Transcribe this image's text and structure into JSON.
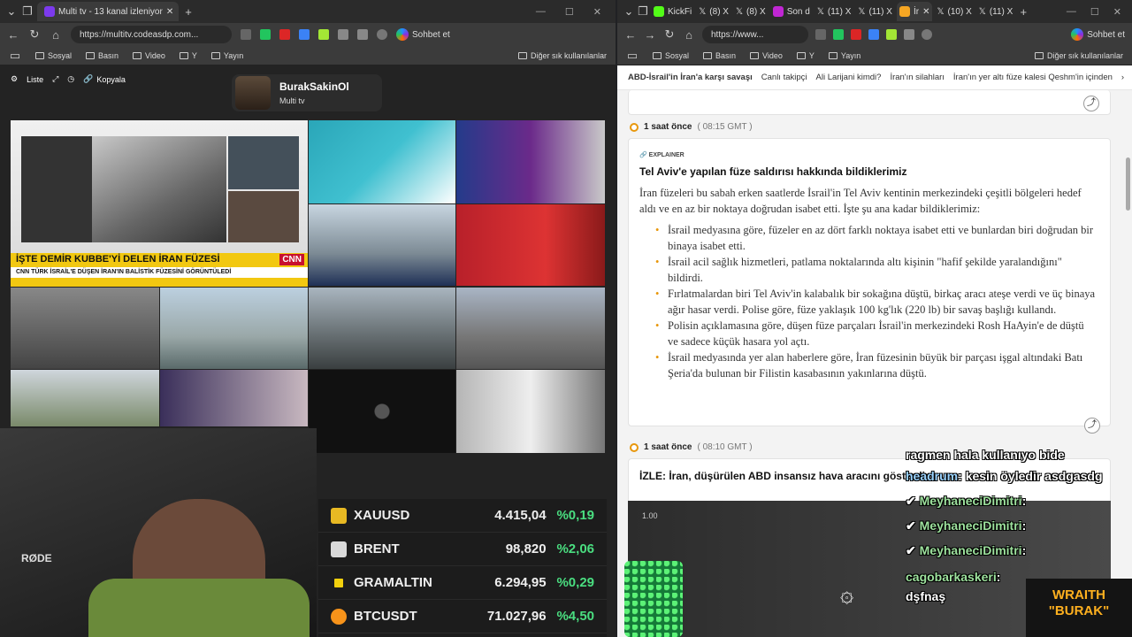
{
  "left": {
    "tab_title": "Multi tv - 13 kanal izleniyor",
    "url": "https://multitv.codeasdp.com...",
    "copilot": "Sohbet et",
    "bookmarks": [
      "Sosyal",
      "Basın",
      "Video",
      "Y",
      "Yayın"
    ],
    "other_bookmarks": "Diğer sık kullanılanlar",
    "toolbar": {
      "list": "Liste",
      "copy": "Kopyala"
    },
    "channel": {
      "name": "BurakSakinOl",
      "sub": "Multi tv"
    },
    "tickers": [
      {
        "symbol": "XAUUSD",
        "price": "4.415,04",
        "change": "%0,19",
        "icon_color": "#e8b923"
      },
      {
        "symbol": "BRENT",
        "price": "98,820",
        "change": "%2,06",
        "icon_color": "#d9d9d9"
      },
      {
        "symbol": "GRAMALTIN",
        "price": "6.294,95",
        "change": "%0,29",
        "icon_color": "#f2d00d"
      },
      {
        "symbol": "BTCUSDT",
        "price": "71.027,96",
        "change": "%4,50",
        "icon_color": "#f7931a"
      }
    ],
    "banner_headline": "İŞTE DEMİR KUBBE'Yİ DELEN İRAN FÜZESİ",
    "banner_sub": "CNN TÜRK İSRAİL'E DÜŞEN İRAN'IN BALİSTİK FÜZESİNİ GÖRÜNTÜLEDİ",
    "cnn_badge": "CNN"
  },
  "right": {
    "tabs": [
      "KickFi",
      "(8) X",
      "(8) X",
      "Son d",
      "(11) X",
      "(11) X",
      "İr",
      "(10) X",
      "(11) X"
    ],
    "url": "https://www...",
    "copilot": "Sohbet et",
    "bookmarks": [
      "Sosyal",
      "Basın",
      "Video",
      "Y",
      "Yayın"
    ],
    "other_bookmarks": "Diğer sık kullanılanlar",
    "topnav": [
      "ABD-İsrail'in İran'a karşı savaşı",
      "Canlı takipçi",
      "Ali Larijani kimdi?",
      "İran'ın silahları",
      "İran'ın yer altı füze kalesi Qeshm'in içinden"
    ],
    "entry1": {
      "ago": "1 saat önce",
      "gmt": "( 08:15 GMT )",
      "tag": "EXPLAINER",
      "title": "Tel Aviv'e yapılan füze saldırısı hakkında bildiklerimiz",
      "para": "İran füzeleri bu sabah erken saatlerde İsrail'in Tel Aviv kentinin merkezindeki çeşitli bölgeleri hedef aldı ve en az bir noktaya doğrudan isabet etti. İşte şu ana kadar bildiklerimiz:",
      "bullets": [
        "İsrail medyasına göre, füzeler en az dört farklı noktaya isabet etti ve bunlardan biri doğrudan bir binaya isabet etti.",
        "İsrail acil sağlık hizmetleri, patlama noktalarında altı kişinin \"hafif şekilde yaralandığını\" bildirdi.",
        "Fırlatmalardan biri Tel Aviv'in kalabalık bir sokağına düştü, birkaç aracı ateşe verdi ve üç binaya ağır hasar verdi. Polise göre, füze yaklaşık 100 kg'lık (220 lb) bir savaş başlığı kullandı.",
        "Polisin açıklamasına göre, düşen füze parçaları İsrail'in merkezindeki Rosh HaAyin'e de düştü ve sadece küçük hasara yol açtı.",
        "İsrail medyasında yer alan haberlere göre, İran füzesinin büyük bir parçası işgal altındaki Batı Şeria'da bulunan bir Filistin kasabasının yakınlarına düştü."
      ]
    },
    "entry2": {
      "ago": "1 saat önce",
      "gmt": "( 08:10 GMT )",
      "title": "İZLE: İran, düşürülen ABD insansız hava aracını gösterdi",
      "video_time": "1.00"
    },
    "chat": [
      {
        "user": "",
        "text": "ragmen hala kullanıyo bide"
      },
      {
        "user": "headrum",
        "text": "kesin öyledir asdgasdg"
      },
      {
        "user": "MeyhaneciDimitri",
        "text": ""
      },
      {
        "user": "MeyhaneciDimitri",
        "text": ""
      },
      {
        "user": "MeyhaneciDimitri",
        "text": ""
      },
      {
        "user": "cagobarkaskeri",
        "text": "dşfnaş"
      }
    ],
    "overlay": "WRAITH \"BURAK\""
  }
}
